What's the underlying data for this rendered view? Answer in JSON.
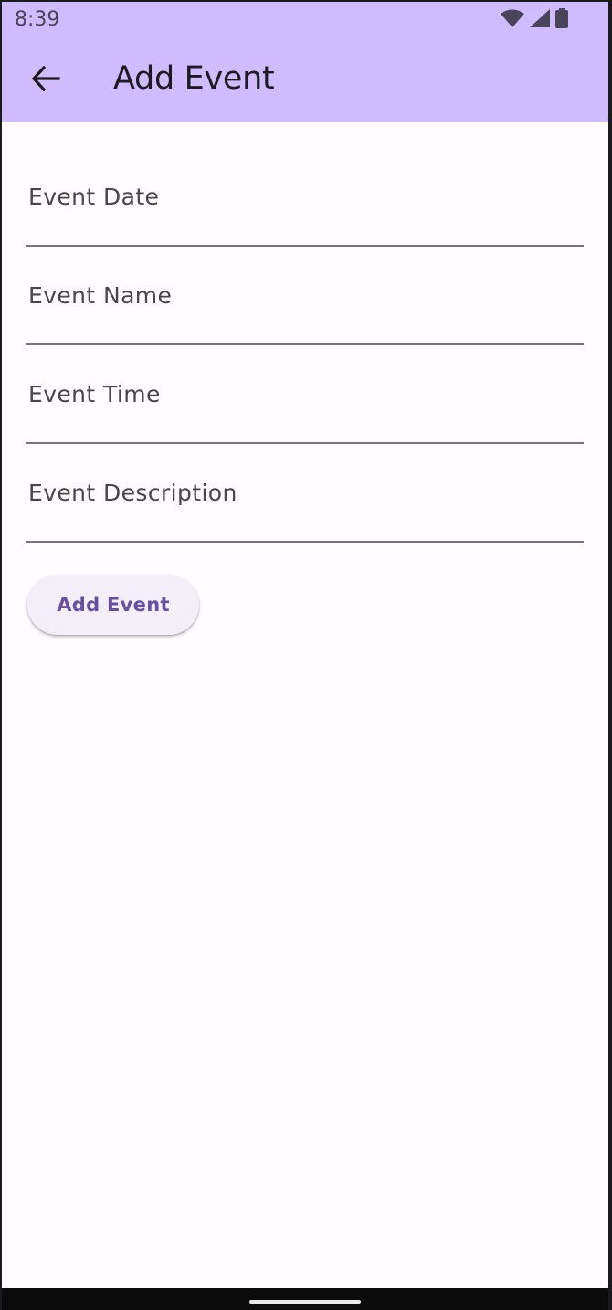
{
  "status_bar": {
    "time": "8:39",
    "icons": [
      "wifi-icon",
      "cellular-signal-icon",
      "battery-icon"
    ]
  },
  "app_bar": {
    "title": "Add Event",
    "back_icon": "arrow-left-icon",
    "background_color": "#cfbcff"
  },
  "form": {
    "fields": [
      {
        "id": "event_date",
        "placeholder": "Event Date",
        "value": ""
      },
      {
        "id": "event_name",
        "placeholder": "Event Name",
        "value": ""
      },
      {
        "id": "event_time",
        "placeholder": "Event Time",
        "value": ""
      },
      {
        "id": "event_description",
        "placeholder": "Event Description",
        "value": ""
      }
    ],
    "submit_label": "Add Event"
  },
  "colors": {
    "accent": "#6750a4",
    "surface": "#fffbfe",
    "outline": "#79747e"
  }
}
